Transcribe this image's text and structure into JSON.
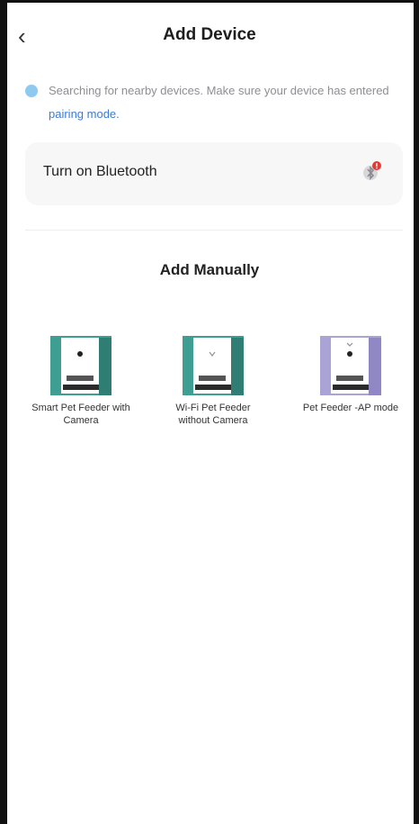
{
  "header": {
    "back_icon": "chevron-left-icon",
    "title": "Add Device"
  },
  "tip": {
    "text": "Searching for nearby devices. Make sure your device has entered ",
    "link": "pairing mode.",
    "icon": "info-dot-icon"
  },
  "bluetooth": {
    "label": "Turn on Bluetooth",
    "icon": "bluetooth-alert-icon"
  },
  "manual": {
    "title": "Add Manually",
    "devices": [
      {
        "label": "Smart Pet Feeder with Camera",
        "color": "#3f9e92"
      },
      {
        "label": "Wi-Fi Pet Feeder without Camera",
        "color": "#3f9e92"
      },
      {
        "label": "Pet Feeder -AP mode",
        "color": "#a9a3d6"
      }
    ]
  }
}
